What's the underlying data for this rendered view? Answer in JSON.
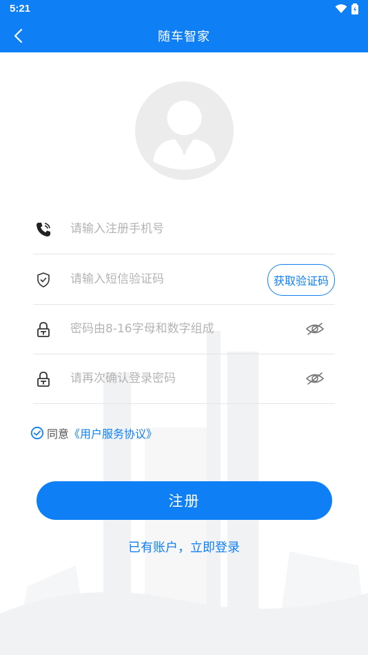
{
  "status_bar": {
    "time": "5:21",
    "icons": [
      "wifi-icon",
      "battery-icon"
    ]
  },
  "header": {
    "title": "随车智家",
    "back_icon": "back-arrow-icon"
  },
  "avatar": {
    "icon": "user-avatar-icon"
  },
  "form": {
    "phone": {
      "icon": "phone-icon",
      "placeholder": "请输入注册手机号",
      "value": ""
    },
    "sms_code": {
      "icon": "shield-icon",
      "placeholder": "请输入短信验证码",
      "value": "",
      "button_label": "获取验证码"
    },
    "password": {
      "icon": "lock-icon",
      "placeholder": "密码由8-16字母和数字组成",
      "value": "",
      "toggle_icon": "eye-hidden-icon"
    },
    "confirm_password": {
      "icon": "lock-icon",
      "placeholder": "请再次确认登录密码",
      "value": "",
      "toggle_icon": "eye-hidden-icon"
    }
  },
  "agreement": {
    "checked": true,
    "prefix": "同意",
    "link": "《用户服务协议》"
  },
  "actions": {
    "register_label": "注册",
    "login_link": "已有账户，立即登录"
  },
  "colors": {
    "primary": "#0f7ff6",
    "placeholder": "#b4b4b4",
    "divider": "#e4e4e4"
  }
}
